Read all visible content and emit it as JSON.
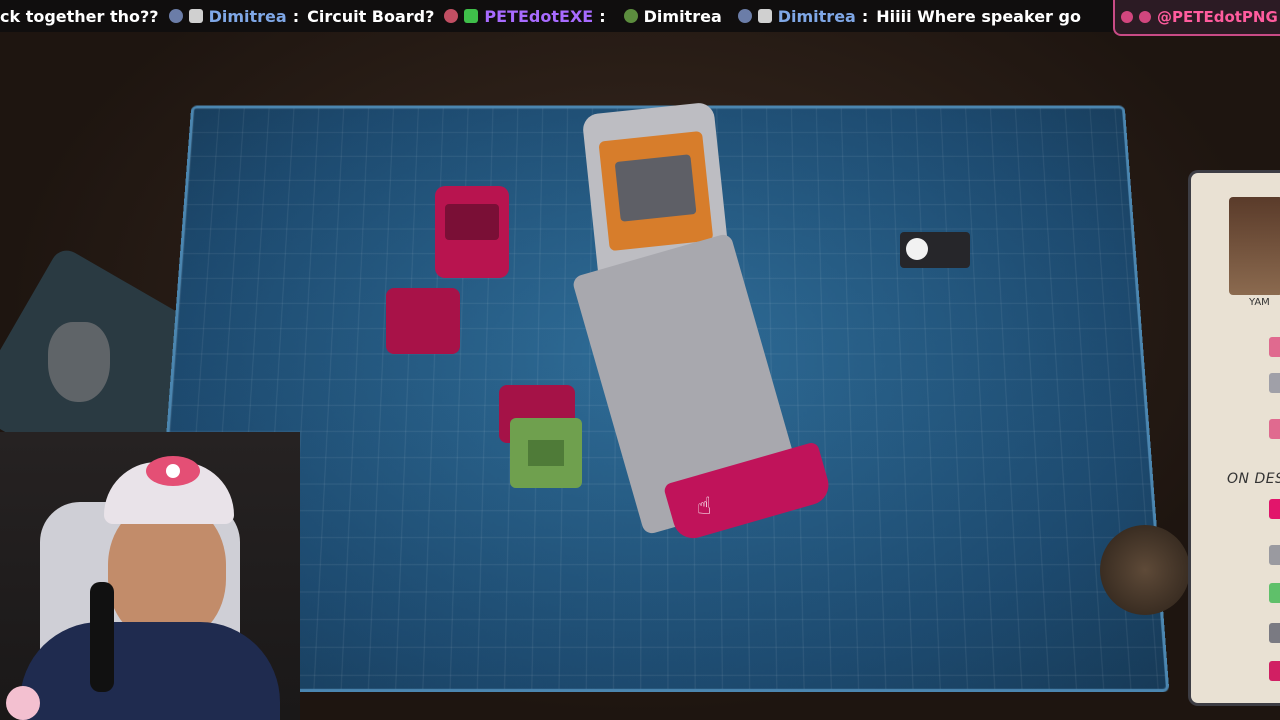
{
  "chat_ticker": {
    "messages": [
      {
        "text": "ck together tho??"
      },
      {
        "user": "Dimitrea",
        "sep": ":",
        "text": "Circuit Board?"
      },
      {
        "user": "PETEdotEXE",
        "sep": ":",
        "text": ""
      },
      {
        "user": "Dimitrea",
        "sep": "",
        "text": ""
      },
      {
        "user": "Dimitrea",
        "sep": ":",
        "text": "Hiiii Where speaker go"
      }
    ]
  },
  "social_handle": "@PETEdotPNG",
  "side_panel": {
    "character_name": "YAM",
    "section_label": "ON DESK",
    "swatch_colors": [
      "#e06a8f",
      "#a0a0a8",
      "#e06a8f",
      "#e2156b",
      "#9a9aa0",
      "#5fc06a",
      "#7a7a82",
      "#d11f63"
    ]
  },
  "colors": {
    "accent_pink": "#c0135a",
    "mat_blue": "#2f6d98",
    "chat_user_blue": "#7fa7e6",
    "chat_user_purple": "#a86bff"
  }
}
